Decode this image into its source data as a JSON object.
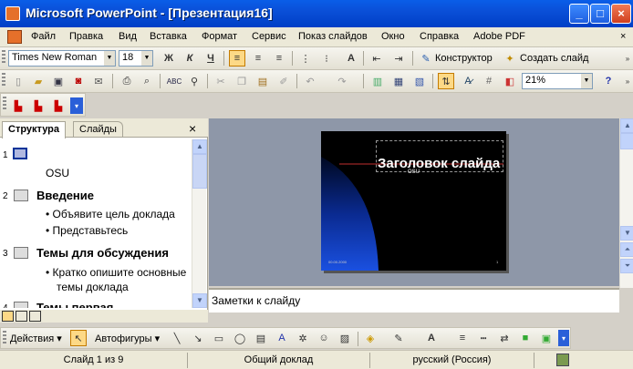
{
  "window": {
    "title": "Microsoft PowerPoint - [Презентация16]"
  },
  "menu": {
    "items": [
      "Файл",
      "Правка",
      "Вид",
      "Вставка",
      "Формат",
      "Сервис",
      "Показ слайдов",
      "Окно",
      "Справка",
      "Adobe PDF"
    ]
  },
  "formatting": {
    "font": "Times New Roman",
    "size": "18",
    "bold": "Ж",
    "italic": "К",
    "underline": "Ч",
    "designer": "Конструктор",
    "new_slide": "Создать слайд"
  },
  "standard": {
    "zoom": "21%"
  },
  "panel": {
    "tab_outline": "Структура",
    "tab_slides": "Слайды",
    "close": "×"
  },
  "outline": [
    {
      "num": "1",
      "title": "",
      "subtitle": "OSU"
    },
    {
      "num": "2",
      "title": "Введение",
      "bullets": [
        "Объявите цель доклада",
        "Представьтесь"
      ]
    },
    {
      "num": "3",
      "title": "Темы для обсуждения",
      "bullets": [
        "Кратко опишите основные темы доклада"
      ]
    },
    {
      "num": "4",
      "title": "Темы первая"
    }
  ],
  "slide": {
    "title": "Заголовок слайда",
    "subtitle": "OSU",
    "date": "00.00.2000",
    "number": "1"
  },
  "notes": {
    "placeholder": "Заметки к слайду"
  },
  "drawing": {
    "actions": "Действия",
    "autoshapes": "Автофигуры"
  },
  "status": {
    "slide": "Слайд 1 из 9",
    "design": "Общий доклад",
    "language": "русский (Россия)"
  }
}
